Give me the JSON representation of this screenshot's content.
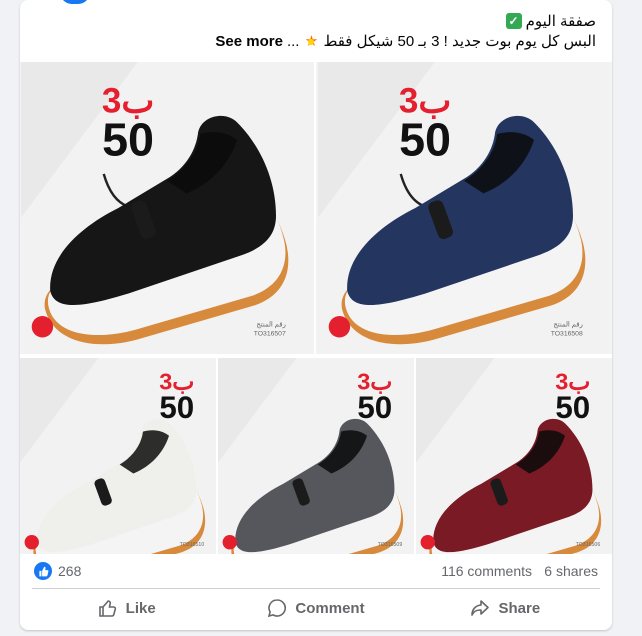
{
  "post": {
    "title": "صفقة اليوم",
    "body": "البس كل يوم بوت جديد  ! 3 بـ 50 شيكل فقط",
    "see_more": "See more",
    "ellipsis": "..."
  },
  "images": [
    {
      "price_top": "3ب",
      "price": "50",
      "shoe_color": "#161616",
      "sole": "#f4f4f4",
      "code_label": "رقم المنتج",
      "code": "TO316507"
    },
    {
      "price_top": "3ب",
      "price": "50",
      "shoe_color": "#243660",
      "sole": "#f4f4f4",
      "code_label": "رقم المنتج",
      "code": "TO316508"
    },
    {
      "price_top": "3ب",
      "price": "50",
      "shoe_color": "#efefeb",
      "sole": "#f4f4f4",
      "code_label": "رقم المنتج",
      "code": "TO316510"
    },
    {
      "price_top": "3ب",
      "price": "50",
      "shoe_color": "#55575c",
      "sole": "#f4f4f4",
      "code_label": "رقم المنتج",
      "code": "TO316509"
    },
    {
      "price_top": "3ب",
      "price": "50",
      "shoe_color": "#7a1a24",
      "sole": "#f4f4f4",
      "code_label": "رقم المنتج",
      "code": "TO316506"
    }
  ],
  "stats": {
    "likes": "268",
    "comments": "116 comments",
    "shares": "6 shares"
  },
  "actions": {
    "like": "Like",
    "comment": "Comment",
    "share": "Share"
  },
  "colors": {
    "accent": "#1877f2",
    "price_red": "#e4202e",
    "outsole": "#d88a3c",
    "muted": "#65676b"
  }
}
